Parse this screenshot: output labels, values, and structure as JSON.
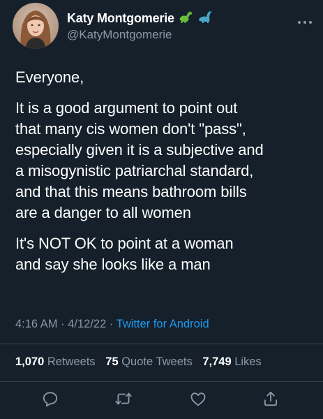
{
  "user": {
    "display_name": "Katy Montgomerie",
    "handle": "@KatyMontgomerie",
    "emoji": [
      "dinosaur-emoji",
      "sauropod-emoji"
    ]
  },
  "tweet": {
    "paragraphs": [
      "Everyone,",
      "It is a good argument to point out\nthat many cis women don't \"pass\",\nespecially given it is a subjective and\na misogynistic patriarchal standard,\nand that this means bathroom bills\nare a danger to all women",
      "It's NOT OK to point at a woman\nand say she looks like a man"
    ]
  },
  "meta": {
    "time": "4:16 AM",
    "date": "4/12/22",
    "separator": " · ",
    "source": "Twitter for Android"
  },
  "stats": {
    "retweets_count": "1,070",
    "retweets_label": "Retweets",
    "quotes_count": "75",
    "quotes_label": "Quote Tweets",
    "likes_count": "7,749",
    "likes_label": "Likes"
  },
  "actions": [
    "reply-icon",
    "retweet-icon",
    "like-icon",
    "share-icon"
  ],
  "colors": {
    "background": "#15202b",
    "text": "#ffffff",
    "secondary": "#8b98a5",
    "link": "#1d9bf0",
    "divider": "#38444d"
  }
}
